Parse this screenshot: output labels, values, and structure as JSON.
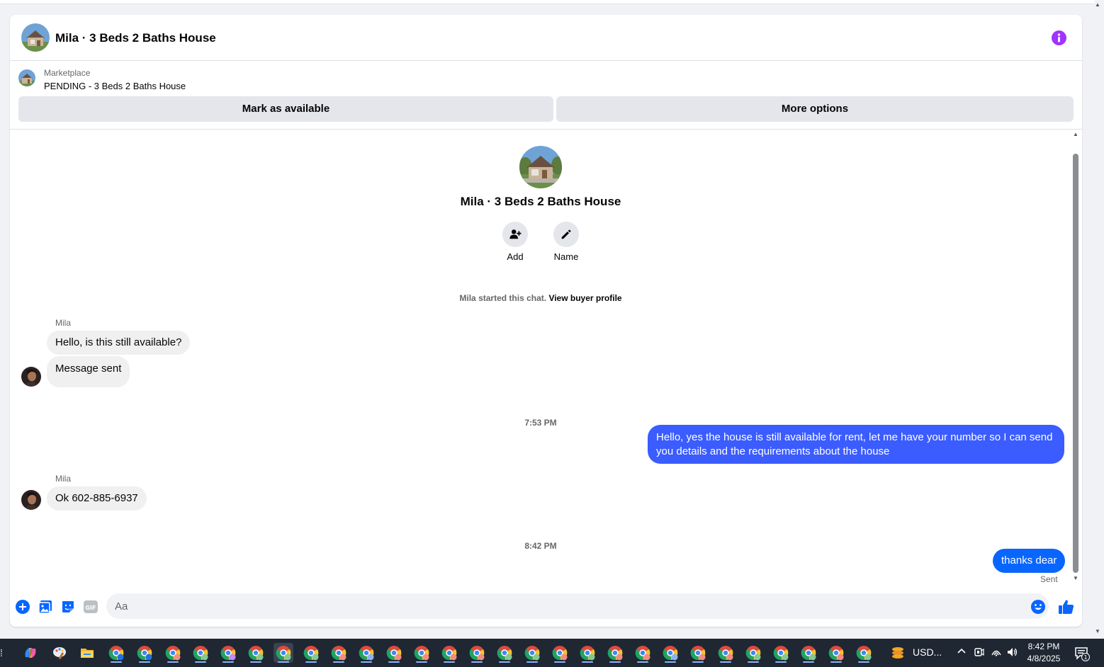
{
  "header": {
    "title": "Mila · 3 Beds 2 Baths House"
  },
  "marketplace": {
    "label": "Marketplace",
    "status": "PENDING - 3 Beds 2 Baths House",
    "mark_available_label": "Mark as available",
    "more_options_label": "More options"
  },
  "chat_intro": {
    "name": "Mila · 3 Beds 2 Baths House",
    "add_label": "Add",
    "name_label": "Name",
    "started_text": "Mila started this chat.",
    "view_profile_label": "View buyer profile"
  },
  "messages": [
    {
      "sender": "Mila",
      "text": "Hello, is this still available?"
    },
    {
      "text": "Message sent"
    },
    {
      "timestamp": "7:53 PM"
    },
    {
      "text": "Hello, yes the house is still available for rent, let me have your number so I can send you details and the requirements about the house"
    },
    {
      "sender": "Mila",
      "text": "Ok 602-885-6937"
    },
    {
      "timestamp": "8:42 PM"
    },
    {
      "text": "thanks dear",
      "status": "Sent"
    }
  ],
  "composer": {
    "placeholder": "Aa"
  },
  "taskbar": {
    "usd_label": "USD...",
    "time": "8:42 PM",
    "date": "4/8/2025",
    "notification_count": "1"
  },
  "colors": {
    "accent_purple": "#a033ff",
    "messenger_blue": "#0866ff",
    "long_bubble_blue": "#3b5cff"
  }
}
